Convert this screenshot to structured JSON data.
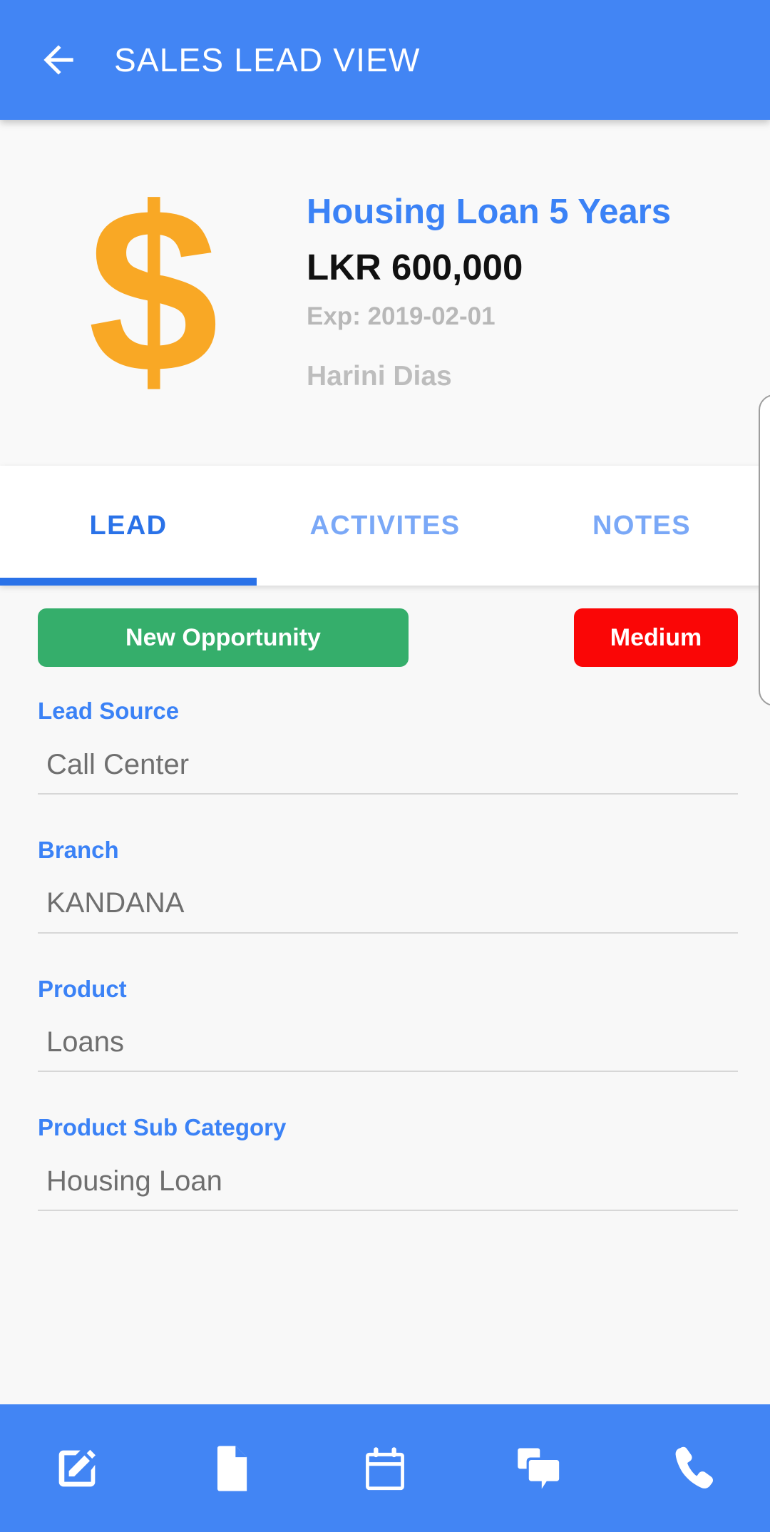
{
  "appbar": {
    "back_icon": "arrow-left-icon",
    "title": "SALES LEAD VIEW",
    "background_color": "#4285F4",
    "title_color": "#FFFFFF"
  },
  "header": {
    "icon": "dollar-sign-icon",
    "icon_glyph": "$",
    "icon_color": "#F9A825",
    "lead_title": "Housing Loan 5 Years",
    "lead_title_color": "#3B82F6",
    "amount": "LKR 600,000",
    "amount_color": "#111111",
    "expiry": "Exp: 2019-02-01",
    "owner": "Harini Dias",
    "muted_color": "#BDBDBD",
    "background_color": "#F9F9F9"
  },
  "tabs": {
    "active_index": 0,
    "active_color": "#2A72E8",
    "inactive_color": "#7AA8F7",
    "items": [
      {
        "label": "LEAD"
      },
      {
        "label": "ACTIVITES"
      },
      {
        "label": "NOTES"
      }
    ]
  },
  "lead_tab": {
    "status": {
      "label": "New Opportunity",
      "color": "#35AE6B"
    },
    "priority": {
      "label": "Medium",
      "color": "#FA0606"
    },
    "fields": [
      {
        "label": "Lead Source",
        "value": "Call Center"
      },
      {
        "label": "Branch",
        "value": "KANDANA"
      },
      {
        "label": "Product",
        "value": "Loans"
      },
      {
        "label": "Product Sub Category",
        "value": "Housing Loan"
      }
    ],
    "label_color": "#3B82F6",
    "value_color": "#6F6F6F",
    "background_color": "#F8F8F8"
  },
  "bottom_nav": {
    "background_color": "#4285F4",
    "items": [
      {
        "icon": "edit-note-icon"
      },
      {
        "icon": "document-icon"
      },
      {
        "icon": "calendar-icon"
      },
      {
        "icon": "chat-bubbles-icon"
      },
      {
        "icon": "phone-icon"
      }
    ]
  }
}
